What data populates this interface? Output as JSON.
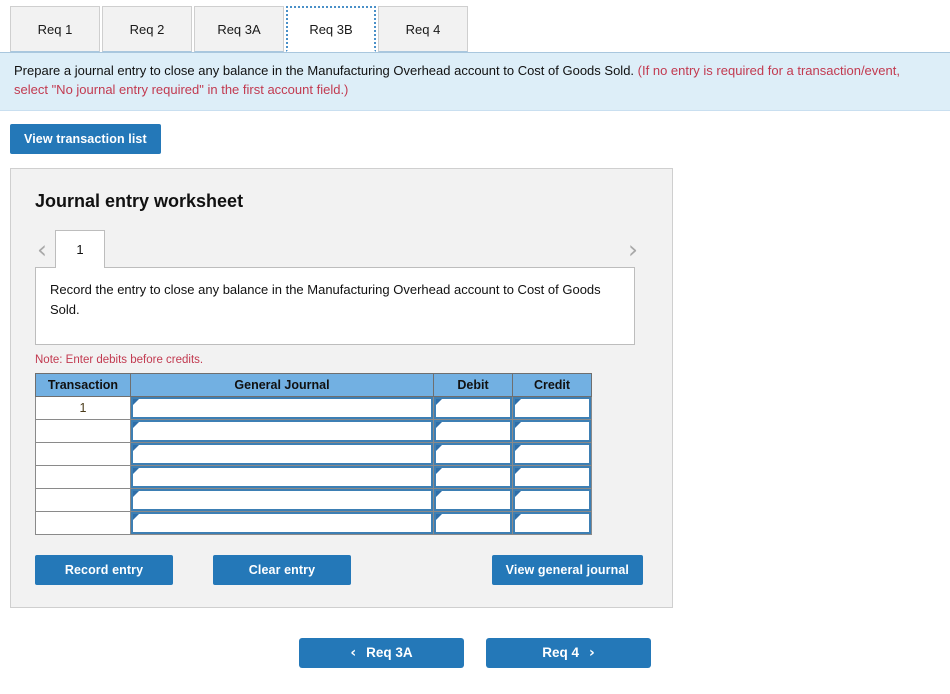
{
  "tabs": [
    {
      "label": "Req 1",
      "active": false
    },
    {
      "label": "Req 2",
      "active": false
    },
    {
      "label": "Req 3A",
      "active": false
    },
    {
      "label": "Req 3B",
      "active": true
    },
    {
      "label": "Req 4",
      "active": false
    }
  ],
  "banner": {
    "black_text": "Prepare a journal entry to close any balance in the Manufacturing Overhead account to Cost of Goods Sold.",
    "red_text": "(If no entry is required for a transaction/event, select \"No journal entry required\" in the first account field.)"
  },
  "toolbar": {
    "view_transaction_list": "View transaction list"
  },
  "worksheet": {
    "title": "Journal entry worksheet",
    "prev_glyph": "‹",
    "next_glyph": "›",
    "page_tabs": [
      "1"
    ],
    "description": "Record the entry to close any balance in the Manufacturing Overhead account to Cost of Goods Sold.",
    "note": "Note: Enter debits before credits."
  },
  "table": {
    "headers": [
      "Transaction",
      "General Journal",
      "Debit",
      "Credit"
    ],
    "rows": [
      {
        "transaction": "1",
        "general_journal": "",
        "debit": "",
        "credit": ""
      },
      {
        "transaction": "",
        "general_journal": "",
        "debit": "",
        "credit": ""
      },
      {
        "transaction": "",
        "general_journal": "",
        "debit": "",
        "credit": ""
      },
      {
        "transaction": "",
        "general_journal": "",
        "debit": "",
        "credit": ""
      },
      {
        "transaction": "",
        "general_journal": "",
        "debit": "",
        "credit": ""
      },
      {
        "transaction": "",
        "general_journal": "",
        "debit": "",
        "credit": ""
      }
    ]
  },
  "actions": {
    "record_entry": "Record entry",
    "clear_entry": "Clear entry",
    "view_general_journal": "View general journal"
  },
  "bottom_nav": {
    "prev_glyph": "‹",
    "prev_label": "Req 3A",
    "next_label": "Req 4",
    "next_glyph": "›"
  },
  "colors": {
    "accent_blue": "#2478b8",
    "banner_bg": "#ddeef8",
    "table_header_blue": "#72b0e2",
    "note_red": "#c23a50",
    "panel_bg": "#f2f2f2"
  }
}
